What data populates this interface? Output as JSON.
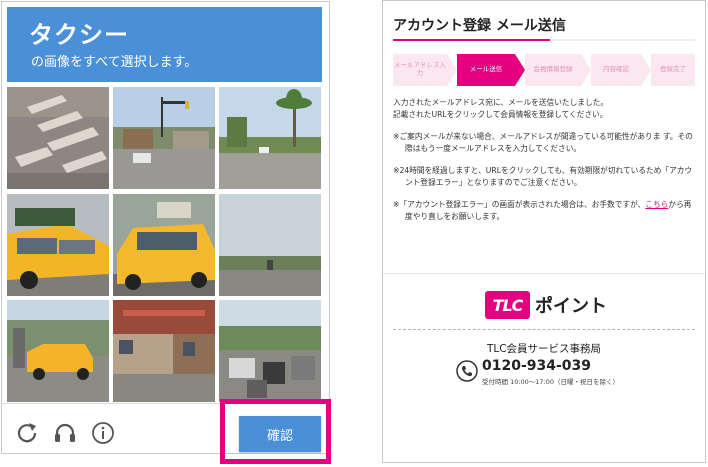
{
  "captcha": {
    "header": {
      "title": "タクシー",
      "instruction": "の画像をすべて選択します。"
    },
    "controls": {
      "confirm_label": "確認"
    }
  },
  "email_screen": {
    "title": "アカウント登録 メール送信",
    "steps": [
      "メールアドレス入力",
      "メール送信",
      "会員情報登録",
      "内容確認",
      "登録完了"
    ],
    "active_step": 1,
    "messages": {
      "sent": "入力されたメールアドレス宛に、メールを送信いたしました。",
      "sent2": "記載されたURLをクリックして会員情報を登録してください。",
      "no_mail": "※ご案内メールが来ない場合、メールアドレスが間違っている可能性がありま す。その際はもう一度メールアドレスを入力してください。",
      "expiry": "※24時間を経過しますと、URLをクリックしても、有効期限が切れているため「アカウント登録エラー」となりますのでご注意ください。",
      "error_prefix": "※「アカウント登録エラー」の画面が表示された場合は、お手数ですが、",
      "error_link": "こちら",
      "error_suffix": "から再度やり直しをお願いします。"
    },
    "brand": {
      "badge": "TLC",
      "word": "ポイント"
    },
    "contact": {
      "office": "TLC会員サービス事務局",
      "phone": "0120-934-039",
      "hours": "受付時間 10:00〜17:00（日曜・祝日を除く）"
    },
    "colors": {
      "accent": "#e4007f",
      "captcha_blue": "#4a90d9"
    }
  }
}
